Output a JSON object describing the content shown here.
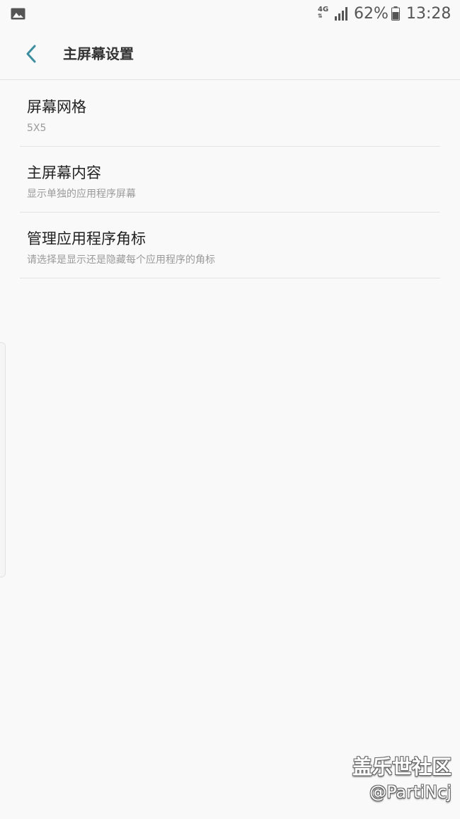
{
  "status_bar": {
    "network": "4G",
    "battery_percent": "62%",
    "time": "13:28",
    "icons": [
      "gallery-icon",
      "signal-icon",
      "battery-icon"
    ]
  },
  "app_bar": {
    "title": "主屏幕设置",
    "back_icon": "chevron-left-icon",
    "accent_color": "#3c8e9e"
  },
  "settings": [
    {
      "title": "屏幕网格",
      "subtitle": "5X5"
    },
    {
      "title": "主屏幕内容",
      "subtitle": "显示单独的应用程序屏幕"
    },
    {
      "title": "管理应用程序角标",
      "subtitle": "请选择是显示还是隐藏每个应用程序的角标"
    }
  ],
  "watermark": {
    "line1": "盖乐世社区",
    "line2": "@PartiNcj"
  }
}
